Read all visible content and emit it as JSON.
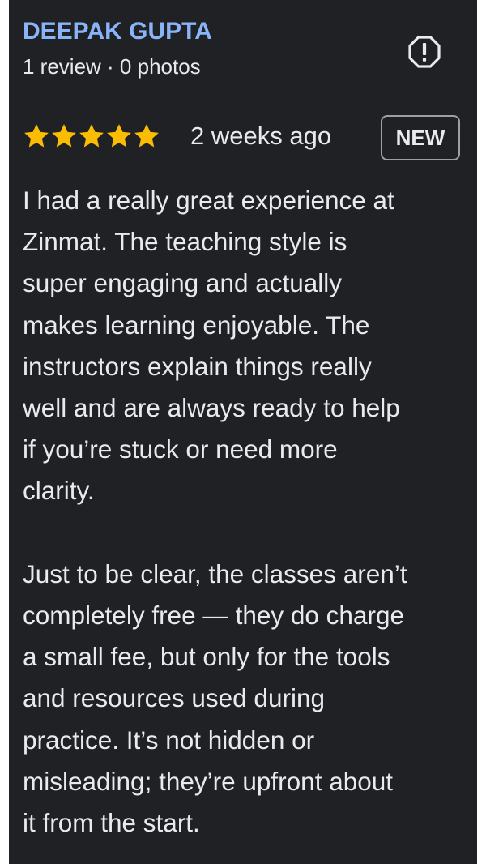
{
  "review": {
    "reviewer_name": "DEEPAK GUPTA",
    "reviewer_meta": "1 review · 0 photos",
    "report_icon": "report-flag-exclamation-icon",
    "rating": 5,
    "rating_max": 5,
    "date": "2 weeks ago",
    "badge": "NEW",
    "paragraph_1": "I had a really great experience at\nZinmat. The teaching style is\nsuper engaging and actually\nmakes learning enjoyable. The\ninstructors explain things really\nwell and are always ready to help\nif you’re stuck or need more\nclarity.",
    "paragraph_2": "Just to be clear, the classes aren’t\ncompletely free — they do charge\na small fee, but only for the tools\nand resources used during\npractice. It’s not hidden or\nmisleading; they’re upfront about\nit from the start."
  },
  "colors": {
    "background": "#202124",
    "name": "#8ab4f8",
    "text": "#e8eaed",
    "star": "#fbbc04",
    "badge_border": "#9aa0a6"
  }
}
